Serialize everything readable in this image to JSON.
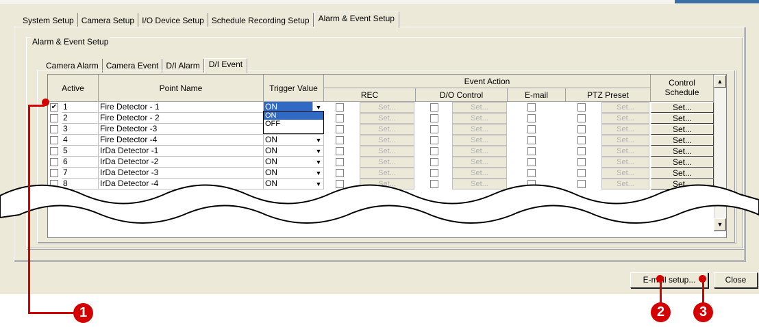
{
  "main_tabs": [
    "System Setup",
    "Camera Setup",
    "I/O Device Setup",
    "Schedule Recording Setup",
    "Alarm & Event Setup"
  ],
  "active_main_tab": "Alarm & Event Setup",
  "group_label": "Alarm & Event Setup",
  "sub_tabs": [
    "Camera Alarm",
    "Camera Event",
    "D/I Alarm",
    "D/I Event"
  ],
  "active_sub_tab": "D/I Event",
  "table": {
    "headers": {
      "active": "Active",
      "point_name": "Point Name",
      "trigger_value": "Trigger Value",
      "event_action": "Event Action",
      "rec": "REC",
      "do_control": "D/O Control",
      "email": "E-mail",
      "ptz_preset": "PTZ Preset",
      "control_schedule": "Control Schedule"
    },
    "set_label": "Set...",
    "rows": [
      {
        "num": "1",
        "name": "Fire Detector - 1",
        "trigger": "ON",
        "active": true
      },
      {
        "num": "2",
        "name": "Fire Detector - 2",
        "trigger": "",
        "active": false
      },
      {
        "num": "3",
        "name": "Fire Detector -3",
        "trigger": "",
        "active": false
      },
      {
        "num": "4",
        "name": "Fire Detector -4",
        "trigger": "ON",
        "active": false
      },
      {
        "num": "5",
        "name": "IrDa Detector -1",
        "trigger": "ON",
        "active": false
      },
      {
        "num": "6",
        "name": "IrDa Detector -2",
        "trigger": "ON",
        "active": false
      },
      {
        "num": "7",
        "name": "IrDa Detector -3",
        "trigger": "ON",
        "active": false
      },
      {
        "num": "8",
        "name": "IrDa Detector -4",
        "trigger": "ON",
        "active": false
      }
    ],
    "dropdown_options": [
      "ON",
      "OFF"
    ]
  },
  "buttons": {
    "email_setup": "E-mail setup...",
    "close": "Close"
  },
  "callouts": [
    "1",
    "2",
    "3"
  ],
  "colors": {
    "callout": "#d40000",
    "selection": "#316ac5",
    "dialog_bg": "#ece9d8"
  }
}
